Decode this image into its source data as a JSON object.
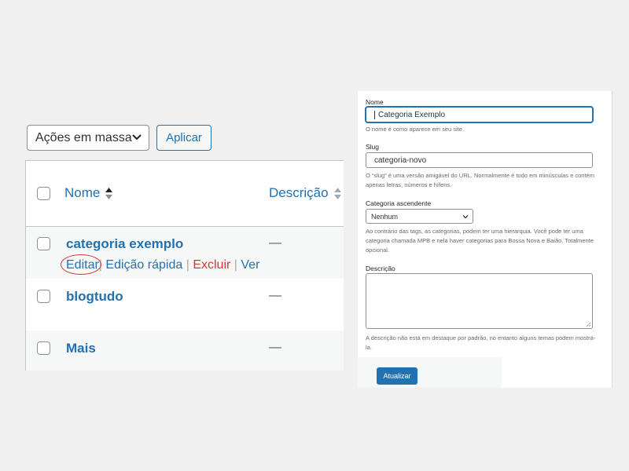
{
  "list": {
    "bulk_actions": "Ações em massa",
    "apply_label": "Aplicar",
    "columns": {
      "name": "Nome",
      "description": "Descrição"
    },
    "rows": [
      {
        "name": "categoria exemplo",
        "description": "—"
      },
      {
        "name": "blogtudo",
        "description": "—"
      },
      {
        "name": "Mais",
        "description": "—"
      }
    ],
    "row_actions": {
      "edit": "Editar",
      "quick_edit": "Edição rápida",
      "delete": "Excluir",
      "view": "Ver",
      "separator": "|"
    }
  },
  "form": {
    "name_label": "Nome",
    "name_value": "Categoria Exemplo",
    "name_hint": "O nome é como aparece em seu site.",
    "slug_label": "Slug",
    "slug_value": "categoria-novo",
    "slug_hint": "O “slug” é uma versão amigável do URL. Normalmente é todo em minúsculas e contém apenas letras, números e hífens.",
    "parent_label": "Categoria ascendente",
    "parent_value": "Nenhum",
    "parent_hint": "Ao contrário das tags, as categorias, podem ter uma hierarquia. Você pode ter uma categoria chamada MPB e nela haver categorias para Bossa Nova e Baião. Totalmente opcional.",
    "description_label": "Descrição",
    "description_value": "",
    "description_hint": "A descrição não está em destaque por padrão, no entanto alguns temas podem mostrá-la.",
    "update_label": "Atualizar"
  },
  "colors": {
    "link": "#2271b1",
    "delete": "#d63638",
    "highlight_circle": "#d63638",
    "primary_button": "#2271b1"
  }
}
